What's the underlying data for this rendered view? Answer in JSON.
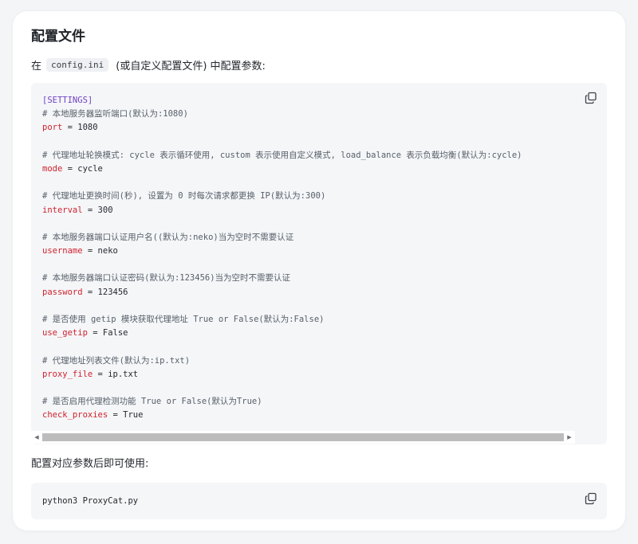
{
  "title": "配置文件",
  "intro": {
    "prefix": "在",
    "filename": "config.ini",
    "suffix": "(或自定义配置文件) 中配置参数:"
  },
  "config_lines": [
    {
      "type": "section",
      "text": "[SETTINGS]"
    },
    {
      "type": "comment",
      "text": "# 本地服务器监听端口(默认为:1080)"
    },
    {
      "type": "kv",
      "key": "port",
      "value": "1080"
    },
    {
      "type": "blank"
    },
    {
      "type": "comment",
      "text": "# 代理地址轮换模式: cycle 表示循环使用, custom 表示使用自定义模式, load_balance 表示负载均衡(默认为:cycle)"
    },
    {
      "type": "kv",
      "key": "mode",
      "value": "cycle"
    },
    {
      "type": "blank"
    },
    {
      "type": "comment",
      "text": "# 代理地址更换时间(秒), 设置为 0 时每次请求都更换 IP(默认为:300)"
    },
    {
      "type": "kv",
      "key": "interval",
      "value": "300"
    },
    {
      "type": "blank"
    },
    {
      "type": "comment",
      "text": "# 本地服务器端口认证用户名((默认为:neko)当为空时不需要认证"
    },
    {
      "type": "kv",
      "key": "username",
      "value": "neko"
    },
    {
      "type": "blank"
    },
    {
      "type": "comment",
      "text": "# 本地服务器端口认证密码(默认为:123456)当为空时不需要认证"
    },
    {
      "type": "kv",
      "key": "password",
      "value": "123456"
    },
    {
      "type": "blank"
    },
    {
      "type": "comment",
      "text": "# 是否使用 getip 模块获取代理地址 True or False(默认为:False)"
    },
    {
      "type": "kv",
      "key": "use_getip",
      "value": "False"
    },
    {
      "type": "blank"
    },
    {
      "type": "comment",
      "text": "# 代理地址列表文件(默认为:ip.txt)"
    },
    {
      "type": "kv",
      "key": "proxy_file",
      "value": "ip.txt"
    },
    {
      "type": "blank"
    },
    {
      "type": "comment",
      "text": "# 是否启用代理检测功能 True or False(默认为True)"
    },
    {
      "type": "kv",
      "key": "check_proxies",
      "value": "True"
    }
  ],
  "outro": "配置对应参数后即可使用:",
  "command": "python3 ProxyCat.py",
  "icons": {
    "copy": "copy-icon",
    "scroll_left": "scroll-left-arrow-icon",
    "scroll_right": "scroll-right-arrow-icon"
  },
  "colors": {
    "section": "#6f42c1",
    "comment": "#57606a",
    "key": "#cf222e",
    "code_bg": "#f5f6f8"
  }
}
